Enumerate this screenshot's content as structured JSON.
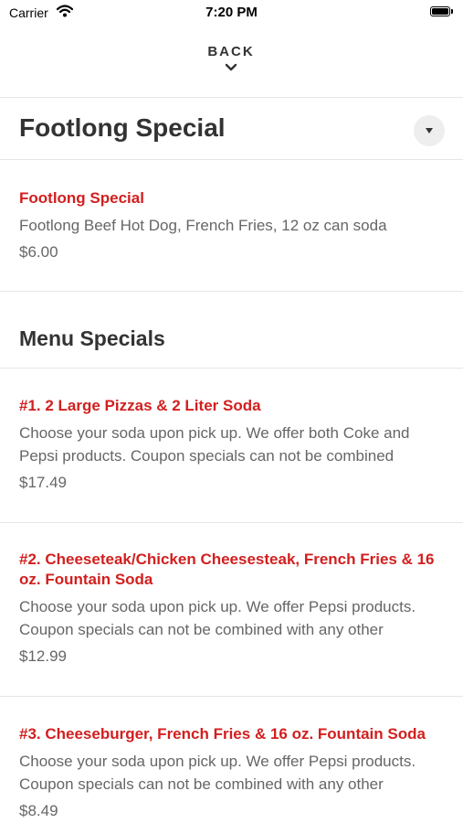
{
  "status_bar": {
    "carrier": "Carrier",
    "time": "7:20 PM"
  },
  "nav": {
    "back_label": "BACK"
  },
  "header": {
    "title": "Footlong Special"
  },
  "featured": {
    "title": "Footlong Special",
    "description": "Footlong Beef Hot Dog, French Fries, 12 oz can soda",
    "price": "$6.00"
  },
  "section": {
    "title": "Menu Specials"
  },
  "items": [
    {
      "title": "#1. 2 Large Pizzas & 2 Liter Soda",
      "description": "Choose your soda upon pick up. We offer both Coke and Pepsi products. Coupon specials can not be combined",
      "price": "$17.49"
    },
    {
      "title": "#2. Cheeseteak/Chicken Cheesesteak, French Fries & 16 oz. Fountain Soda",
      "description": "Choose your soda upon pick up. We offer Pepsi products. Coupon specials can not be combined with any other",
      "price": "$12.99"
    },
    {
      "title": "#3. Cheeseburger, French Fries & 16 oz. Fountain Soda",
      "description": "Choose your soda upon pick up. We offer Pepsi products. Coupon specials can not be combined with any other",
      "price": "$8.49"
    }
  ],
  "colors": {
    "accent": "#d21f1f",
    "text": "#333333",
    "muted": "#666666",
    "divider": "#e6e6e6"
  },
  "icons": {
    "wifi": "wifi-icon",
    "battery": "battery-icon",
    "back": "chevron-down-icon",
    "dropdown": "caret-down-icon"
  }
}
